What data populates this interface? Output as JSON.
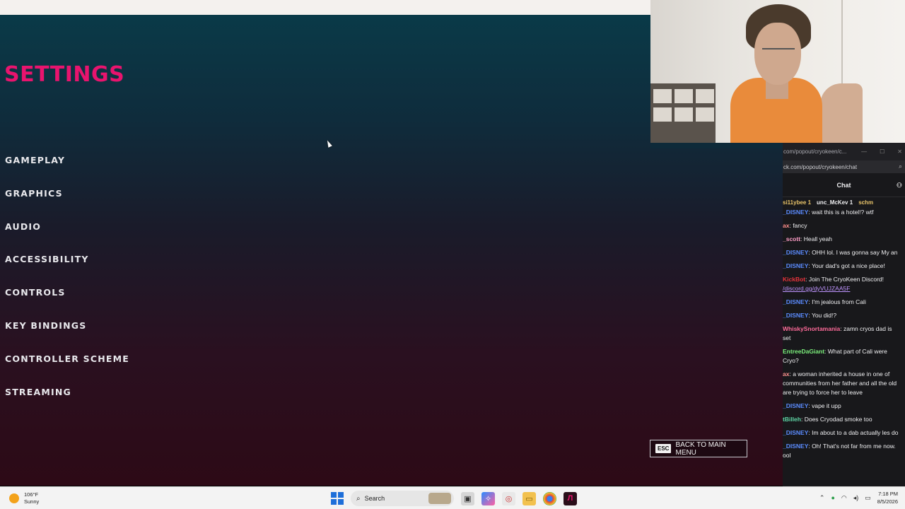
{
  "game": {
    "title": "SETTINGS",
    "menu": [
      "GAMEPLAY",
      "GRAPHICS",
      "AUDIO",
      "ACCESSIBILITY",
      "CONTROLS",
      "KEY BINDINGS",
      "CONTROLLER SCHEME",
      "STREAMING"
    ],
    "back_key": "ESC",
    "back_label": "BACK TO MAIN MENU",
    "colors": {
      "title": "#e8146e",
      "menu_text": "#e8e8ec"
    }
  },
  "chat": {
    "window_title": "com/popout/cryokeen/c...",
    "url": "ck.com/popout/cryokeen/chat",
    "header": "Chat",
    "gifters": [
      "si11ybee 1",
      "unc_McKev 1",
      "schm"
    ],
    "messages": [
      {
        "user": "_DISNEY",
        "color": "#5b8cff",
        "text": ": wait this is a hotel!? wtf"
      },
      {
        "user": "ax",
        "color": "#ff8f8f",
        "text": ": fancy"
      },
      {
        "user": "_scott",
        "color": "#ff9ec7",
        "text": ": Heall yeah"
      },
      {
        "user": "_DISNEY",
        "color": "#5b8cff",
        "text": ": OHH lol. I was gonna say My an"
      },
      {
        "user": "_DISNEY",
        "color": "#5b8cff",
        "text": ": Your dad's got a nice place!"
      },
      {
        "user": "KickBot",
        "color": "#e8343c",
        "text": ": Join The CryoKeen Discord!",
        "link": "/discord.gg/dyVUJZAA5F"
      },
      {
        "user": "_DISNEY",
        "color": "#5b8cff",
        "text": ": I'm jealous from Cali"
      },
      {
        "user": "_DISNEY",
        "color": "#5b8cff",
        "text": ": You did!?"
      },
      {
        "user": "WhiskySnortamania",
        "color": "#ff6b9a",
        "text": ": zamn cryos dad is set"
      },
      {
        "user": "EntreeDaGiant",
        "color": "#7cf07c",
        "text": ": What part of Cali were Cryo?"
      },
      {
        "user": "ax",
        "color": "#ff8f8f",
        "text": ": a woman inherited a house in one of communities from her father and all the old are trying to force her to leave"
      },
      {
        "user": "_DISNEY",
        "color": "#5b8cff",
        "text": ": vape it upp"
      },
      {
        "user": "tBilleh",
        "color": "#5fd6a6",
        "text": ": Does Cryodad smoke too"
      },
      {
        "user": "_DISNEY",
        "color": "#5b8cff",
        "text": ": Im about to a dab actually les do"
      },
      {
        "user": "_DISNEY",
        "color": "#5b8cff",
        "text": ": Oh! That's not far from me now. ool"
      }
    ]
  },
  "taskbar": {
    "temp": "106°F",
    "weather": "Sunny",
    "search_label": "Search",
    "time": "7:18 PM",
    "date": "8/5/2026"
  }
}
